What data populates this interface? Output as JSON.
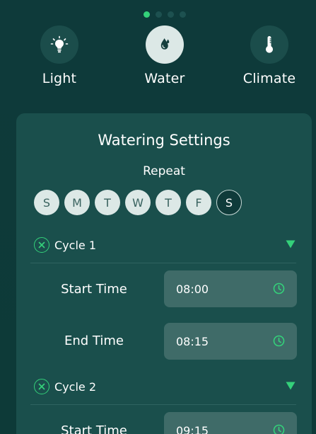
{
  "pager": {
    "count": 4,
    "active": 0
  },
  "categories": [
    {
      "label": "Light",
      "icon": "lightbulb-icon",
      "active": false
    },
    {
      "label": "Water",
      "icon": "water-drop-icon",
      "active": true
    },
    {
      "label": "Climate",
      "icon": "thermometer-icon",
      "active": false
    }
  ],
  "settings": {
    "title": "Watering Settings",
    "repeat_label": "Repeat",
    "days": [
      {
        "label": "S",
        "selected": true
      },
      {
        "label": "M",
        "selected": true
      },
      {
        "label": "T",
        "selected": true
      },
      {
        "label": "W",
        "selected": true
      },
      {
        "label": "T",
        "selected": true
      },
      {
        "label": "F",
        "selected": true
      },
      {
        "label": "S",
        "selected": false
      }
    ],
    "cycles": [
      {
        "label": "Cycle 1",
        "start_label": "Start Time",
        "start_time": "08:00",
        "end_label": "End Time",
        "end_time": "08:15"
      },
      {
        "label": "Cycle 2",
        "start_label": "Start Time",
        "start_time": "09:15"
      }
    ]
  },
  "colors": {
    "background": "#0f3a3a",
    "card": "#1a4f4c",
    "accent": "#34d17a",
    "field": "#3f6b68",
    "pill": "#dce8e6"
  }
}
